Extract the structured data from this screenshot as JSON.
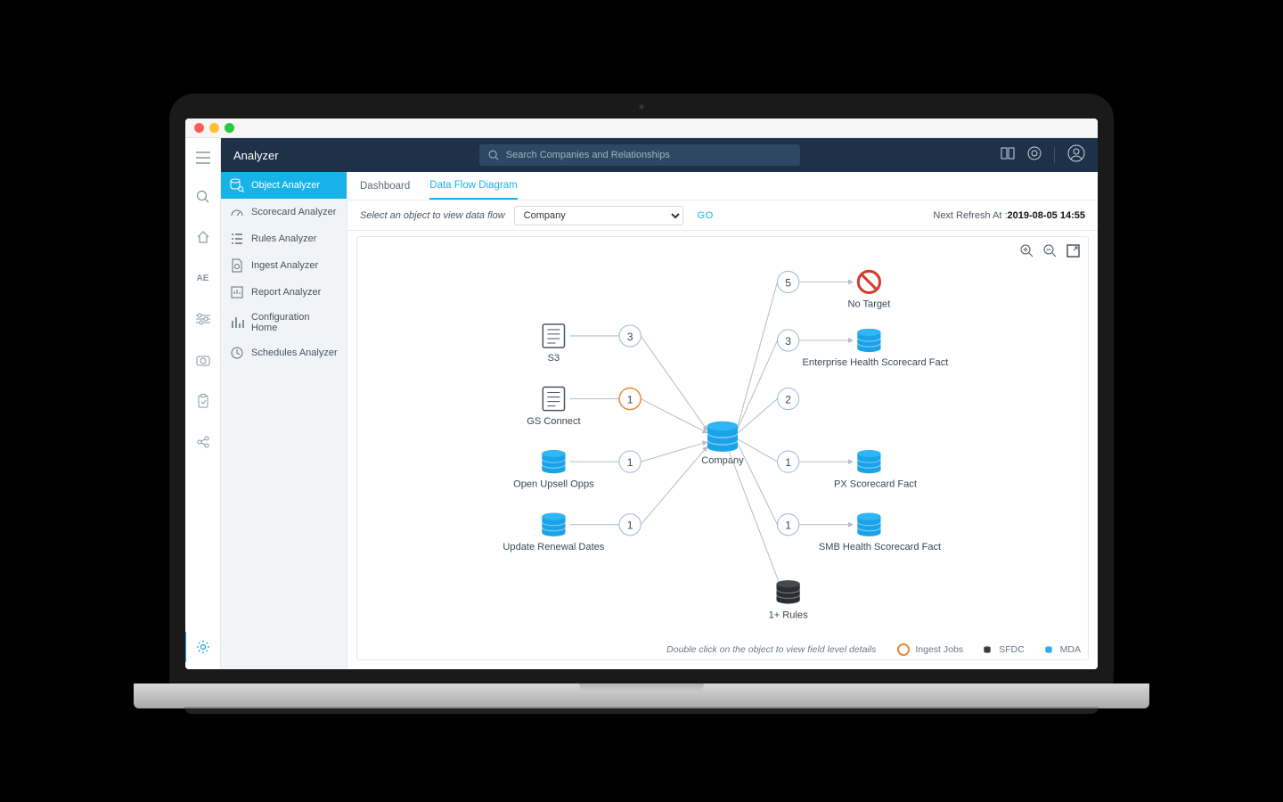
{
  "header": {
    "title": "Analyzer",
    "search_placeholder": "Search Companies and Relationships"
  },
  "sidebar": {
    "items": [
      {
        "label": "Object Analyzer"
      },
      {
        "label": "Scorecard Analyzer"
      },
      {
        "label": "Rules Analyzer"
      },
      {
        "label": "Ingest Analyzer"
      },
      {
        "label": "Report Analyzer"
      },
      {
        "label": "Configuration Home"
      },
      {
        "label": "Schedules Analyzer"
      }
    ]
  },
  "icon_rail": {
    "ae_label": "AE"
  },
  "tabs": {
    "dashboard": "Dashboard",
    "dataflow": "Data Flow Diagram"
  },
  "filter": {
    "label": "Select an object to view data flow",
    "selected": "Company",
    "go": "GO",
    "refresh_prefix": "Next Refresh At :",
    "refresh_time": "2019-08-05 14:55"
  },
  "diagram": {
    "center": "Company",
    "sources": [
      {
        "name": "S3",
        "count": "3",
        "icon": "file"
      },
      {
        "name": "GS Connect",
        "count": "1",
        "icon": "file",
        "highlight": true
      },
      {
        "name": "Open Upsell Opps",
        "count": "1",
        "icon": "db-blue"
      },
      {
        "name": "Update Renewal Dates",
        "count": "1",
        "icon": "db-blue"
      }
    ],
    "targets": [
      {
        "name": "No Target",
        "count": "5",
        "icon": "forbidden"
      },
      {
        "name": "Enterprise Health Scorecard Fact",
        "count": "3",
        "icon": "db-blue"
      },
      {
        "name": "",
        "count": "2",
        "icon": "none"
      },
      {
        "name": "PX Scorecard Fact",
        "count": "1",
        "icon": "db-blue"
      },
      {
        "name": "SMB Health Scorecard Fact",
        "count": "1",
        "icon": "db-blue"
      }
    ],
    "rules": "1+ Rules",
    "hint": "Double click on the object to view field level details"
  },
  "legend": {
    "ingest": "Ingest Jobs",
    "sfdc": "SFDC",
    "mda": "MDA"
  }
}
